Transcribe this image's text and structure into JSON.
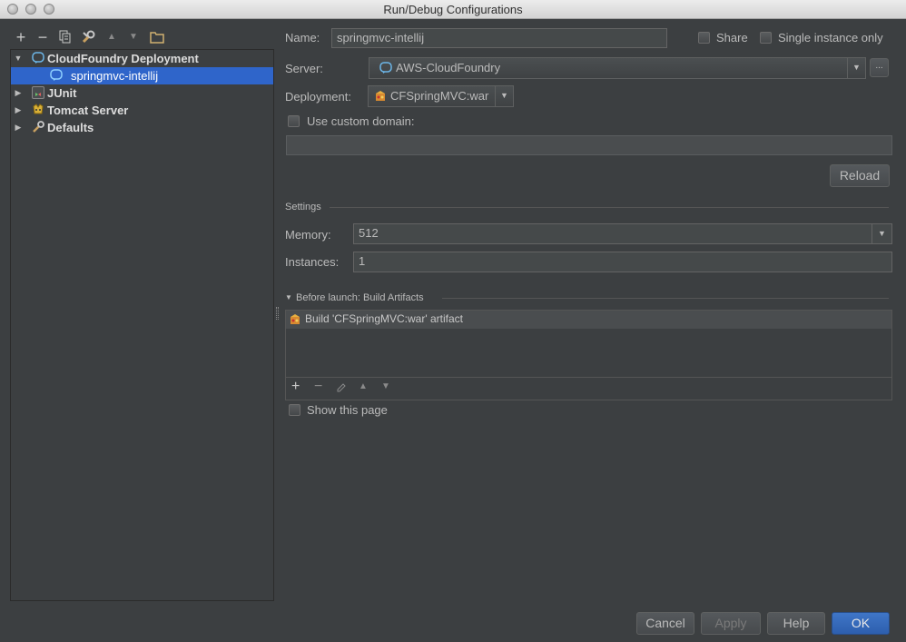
{
  "window": {
    "title": "Run/Debug Configurations"
  },
  "toolbar": {
    "add": "+",
    "remove": "−",
    "copy": "copy-icon",
    "edit_defaults": "wrench-icon",
    "move_up": "▲",
    "move_down": "▼",
    "folder": "folder-icon"
  },
  "tree": {
    "items": [
      {
        "label": "CloudFoundry Deployment",
        "expanded": true,
        "icon": "cloudfoundry-icon"
      },
      {
        "label": "springmvc-intellij",
        "selected": true,
        "icon": "cloudfoundry-icon"
      },
      {
        "label": "JUnit",
        "expanded": false,
        "icon": "junit-icon"
      },
      {
        "label": "Tomcat Server",
        "expanded": false,
        "icon": "tomcat-icon"
      },
      {
        "label": "Defaults",
        "expanded": false,
        "icon": "defaults-icon"
      }
    ]
  },
  "form": {
    "name_label": "Name:",
    "name_value": "springmvc-intellij",
    "share_label": "Share",
    "single_instance_label": "Single instance only",
    "server_label": "Server:",
    "server_value": "AWS-CloudFoundry",
    "server_more": "...",
    "deployment_label": "Deployment:",
    "deployment_value": "CFSpringMVC:war",
    "custom_domain_label": "Use custom domain:",
    "custom_domain_value": "",
    "reload_label": "Reload",
    "settings_label": "Settings",
    "memory_label": "Memory:",
    "memory_value": "512",
    "instances_label": "Instances:",
    "instances_value": "1",
    "before_launch_label": "Before launch: Build Artifacts",
    "before_launch_items": [
      "Build 'CFSpringMVC:war' artifact"
    ],
    "bl_add": "+",
    "bl_remove": "−",
    "show_page_label": "Show this page"
  },
  "buttons": {
    "cancel": "Cancel",
    "apply": "Apply",
    "help": "Help",
    "ok": "OK"
  },
  "colors": {
    "background": "#3c3f41",
    "selection": "#2f65ca",
    "primary_button": "#3467ba"
  }
}
